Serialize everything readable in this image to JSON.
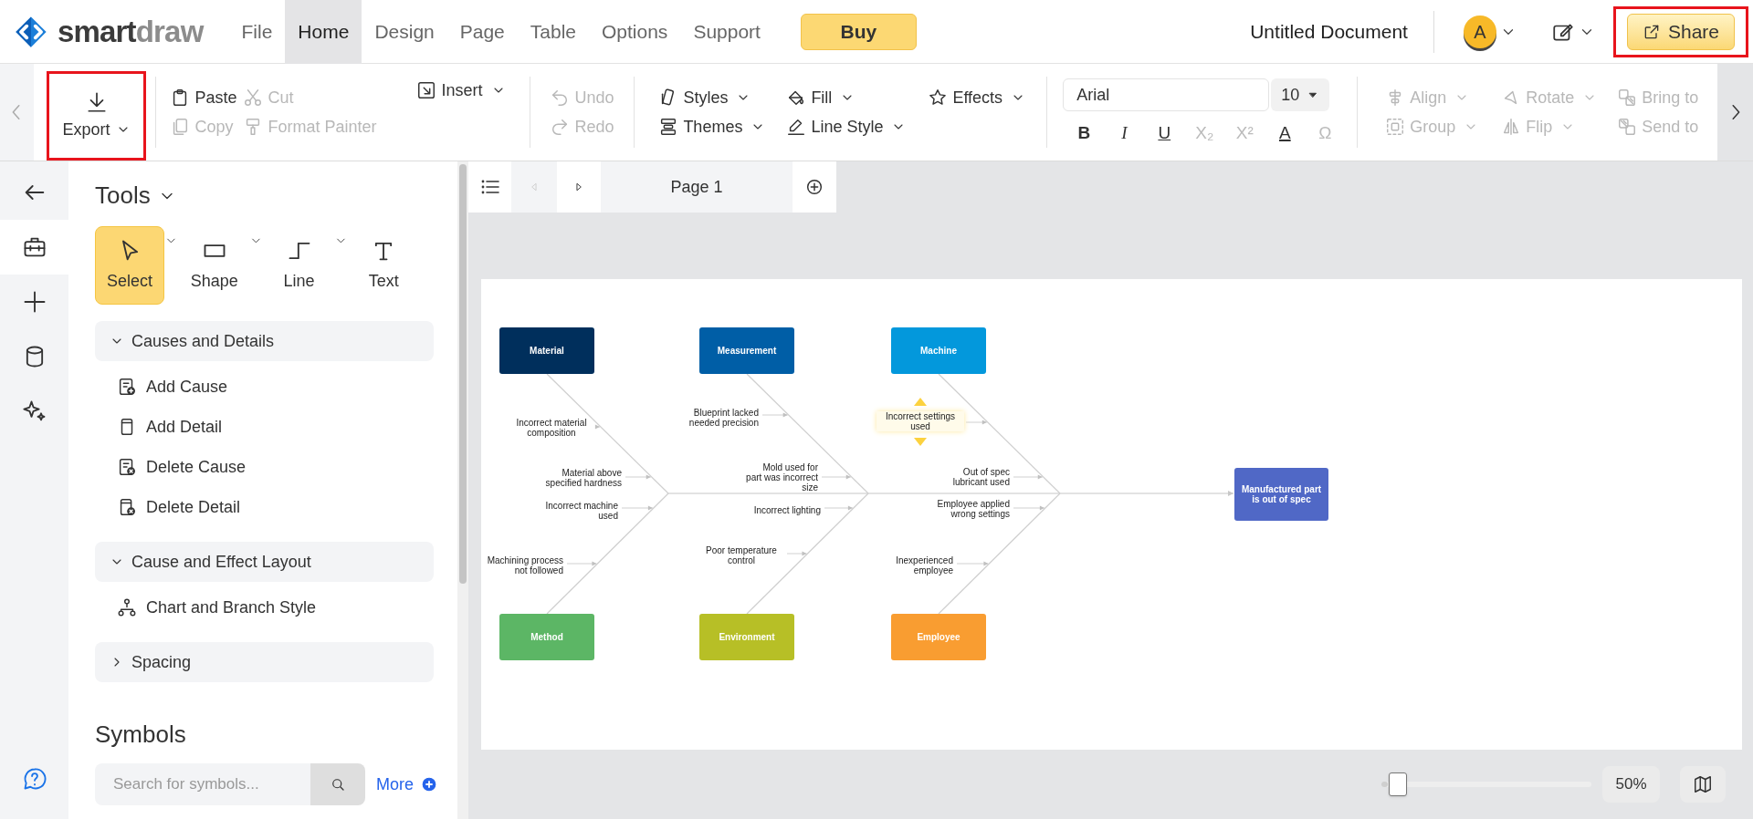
{
  "logo": {
    "first": "smart",
    "second": "draw"
  },
  "menu": [
    {
      "label": "File",
      "selected": false
    },
    {
      "label": "Home",
      "selected": true
    },
    {
      "label": "Design",
      "selected": false
    },
    {
      "label": "Page",
      "selected": false
    },
    {
      "label": "Table",
      "selected": false
    },
    {
      "label": "Options",
      "selected": false
    },
    {
      "label": "Support",
      "selected": false
    }
  ],
  "buy_button": "Buy",
  "document_title": "Untitled Document",
  "avatar": "A",
  "share_button": {
    "label": "Share",
    "highlighted": true
  },
  "ribbon": {
    "export": {
      "label": "Export",
      "highlighted": true
    },
    "clipboard": [
      {
        "label": "Paste",
        "disabled": false
      },
      {
        "label": "Cut",
        "disabled": true
      },
      {
        "label": "Copy",
        "disabled": true
      },
      {
        "label": "Format Painter",
        "disabled": true
      }
    ],
    "insert": "Insert",
    "history": [
      {
        "label": "Undo",
        "disabled": true
      },
      {
        "label": "Redo",
        "disabled": true
      }
    ],
    "style_menus": [
      "Styles",
      "Fill",
      "Effects",
      "Themes",
      "Line Style"
    ],
    "font_family": "Arial",
    "font_size": "10",
    "text_format": [
      {
        "glyph": "B",
        "disabled": false
      },
      {
        "glyph": "I",
        "disabled": false
      },
      {
        "glyph": "U",
        "disabled": false
      },
      {
        "glyph": "X₂",
        "disabled": true
      },
      {
        "glyph": "X²",
        "disabled": true
      },
      {
        "glyph": "A",
        "disabled": false
      },
      {
        "glyph": "Ω",
        "disabled": true
      }
    ],
    "arrange": [
      {
        "label": "Align",
        "disabled": true
      },
      {
        "label": "Rotate",
        "disabled": true
      },
      {
        "label": "Bring to",
        "disabled": true
      },
      {
        "label": "Group",
        "disabled": true
      },
      {
        "label": "Flip",
        "disabled": true
      },
      {
        "label": "Send to",
        "disabled": true
      }
    ]
  },
  "rail": [
    {
      "selected": false
    },
    {
      "selected": true
    },
    {
      "selected": false
    },
    {
      "selected": false
    },
    {
      "selected": false
    },
    {
      "selected": false
    }
  ],
  "panel": {
    "title": "Tools",
    "tools": [
      {
        "label": "Select",
        "selected": true,
        "has_menu": true
      },
      {
        "label": "Shape",
        "selected": false,
        "has_menu": true
      },
      {
        "label": "Line",
        "selected": false,
        "has_menu": true
      },
      {
        "label": "Text",
        "selected": false,
        "has_menu": false
      }
    ],
    "sections": [
      {
        "title": "Causes and Details",
        "expanded": true,
        "items": [
          "Add Cause",
          "Add Detail",
          "Delete Cause",
          "Delete Detail"
        ]
      },
      {
        "title": "Cause and Effect Layout",
        "expanded": true,
        "items": [
          "Chart and Branch Style"
        ]
      },
      {
        "title": "Spacing",
        "expanded": false
      }
    ],
    "symbols_title": "Symbols",
    "search_placeholder": "Search for symbols...",
    "more_link": "More"
  },
  "page_tabs": [
    {
      "label": "Page 1",
      "selected": true
    }
  ],
  "diagram": {
    "effect": "Manufactured part is out of spec",
    "categories": [
      {
        "label": "Material",
        "color": "#002f5c",
        "causes": [
          {
            "text": "Incorrect material composition",
            "selected": false
          },
          {
            "text": "Material above specified hardness",
            "selected": false
          }
        ]
      },
      {
        "label": "Measurement",
        "color": "#005ea6",
        "causes": [
          {
            "text": "Blueprint lacked needed precision",
            "selected": false
          },
          {
            "text": "Mold used for part was incorrect size",
            "selected": false
          }
        ]
      },
      {
        "label": "Machine",
        "color": "#0398dc",
        "causes": [
          {
            "text": "Incorrect settings used",
            "selected": true
          },
          {
            "text": "Out of spec lubricant used",
            "selected": false
          }
        ]
      },
      {
        "label": "Method",
        "color": "#5cb665",
        "causes": [
          {
            "text": "Incorrect machine used",
            "selected": false
          },
          {
            "text": "Machining process not followed",
            "selected": false
          }
        ]
      },
      {
        "label": "Environment",
        "color": "#b7bf26",
        "causes": [
          {
            "text": "Incorrect lighting",
            "selected": false
          },
          {
            "text": "Poor temperature control",
            "selected": false
          }
        ]
      },
      {
        "label": "Employee",
        "color": "#f99d31",
        "causes": [
          {
            "text": "Employee applied wrong settings",
            "selected": false
          },
          {
            "text": "Inexperienced employee",
            "selected": false
          }
        ]
      }
    ]
  },
  "zoom": {
    "level": 0.08,
    "reading": "50%"
  }
}
